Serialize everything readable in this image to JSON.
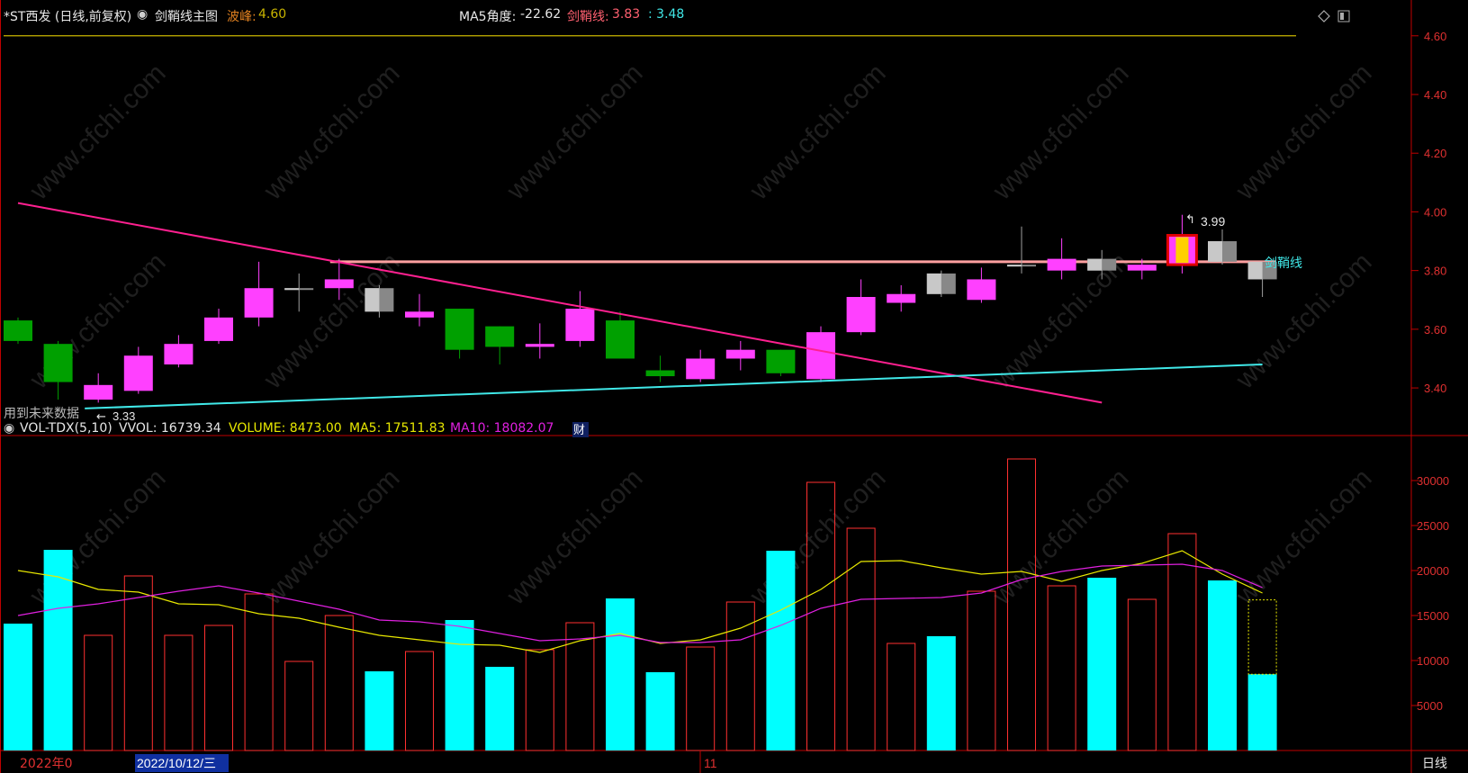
{
  "header": {
    "stock_title": "*ST西发 (日线,前复权)",
    "indicator_name": "剑鞘线主图",
    "peak_label": "波峰:",
    "peak_value": "4.60",
    "ma5_angle_label": "MA5角度:",
    "ma5_angle_value": "-22.62",
    "sword_label": "剑鞘线:",
    "sword_value": "3.83",
    "support_value": ": 3.48"
  },
  "volume_header": {
    "name": "VOL-TDX(5,10)",
    "vvol": "VVOL: 16739.34",
    "volume": "VOLUME: 8473.00",
    "ma5": "MA5: 17511.83",
    "ma10": "MA10: 18082.07"
  },
  "annotations": {
    "future_data": "用到未来数据",
    "low_marker": "3.33",
    "high_marker": "3.99",
    "sword_line_label": "剑鞘线",
    "finance_marker": "财"
  },
  "footer": {
    "year_label": "2022年0",
    "date_cursor": "2022/10/12/三",
    "month_label": "11",
    "period_button": "日线"
  },
  "colors": {
    "up": "#ff40ff",
    "down": "#00a000",
    "neutral": "#a0a0a0",
    "trend_line": "#ff2090",
    "support_line": "#40e8e8",
    "sword_line": "#ffa0a0",
    "peak_line": "#c8b400",
    "axis": "#c00000",
    "vol_up": "#ff3030",
    "vol_down": "#00ffff",
    "ma5": "#e8e800",
    "ma10": "#e020e0"
  },
  "chart_data": [
    {
      "type": "candlestick",
      "title": "*ST西发 (日线,前复权)",
      "ylim": [
        3.25,
        4.63
      ],
      "yticks": [
        "4.60",
        "4.40",
        "4.20",
        "4.00",
        "3.80",
        "3.60",
        "3.40"
      ],
      "peak_level": 4.6,
      "sword_level": 3.83,
      "candles": [
        {
          "o": 3.63,
          "h": 3.64,
          "l": 3.55,
          "c": 3.56,
          "s": "down"
        },
        {
          "o": 3.55,
          "h": 3.56,
          "l": 3.36,
          "c": 3.42,
          "s": "down"
        },
        {
          "o": 3.36,
          "h": 3.45,
          "l": 3.35,
          "c": 3.41,
          "s": "up"
        },
        {
          "o": 3.39,
          "h": 3.54,
          "l": 3.38,
          "c": 3.51,
          "s": "up"
        },
        {
          "o": 3.48,
          "h": 3.58,
          "l": 3.47,
          "c": 3.55,
          "s": "up"
        },
        {
          "o": 3.56,
          "h": 3.67,
          "l": 3.55,
          "c": 3.64,
          "s": "up"
        },
        {
          "o": 3.64,
          "h": 3.83,
          "l": 3.61,
          "c": 3.74,
          "s": "up"
        },
        {
          "o": 3.74,
          "h": 3.79,
          "l": 3.66,
          "c": 3.74,
          "s": "neutral"
        },
        {
          "o": 3.74,
          "h": 3.84,
          "l": 3.7,
          "c": 3.77,
          "s": "up"
        },
        {
          "o": 3.74,
          "h": 3.75,
          "l": 3.64,
          "c": 3.66,
          "s": "neutral"
        },
        {
          "o": 3.64,
          "h": 3.72,
          "l": 3.61,
          "c": 3.66,
          "s": "up"
        },
        {
          "o": 3.67,
          "h": 3.67,
          "l": 3.5,
          "c": 3.53,
          "s": "down"
        },
        {
          "o": 3.61,
          "h": 3.61,
          "l": 3.48,
          "c": 3.54,
          "s": "down"
        },
        {
          "o": 3.54,
          "h": 3.62,
          "l": 3.5,
          "c": 3.55,
          "s": "up"
        },
        {
          "o": 3.56,
          "h": 3.73,
          "l": 3.54,
          "c": 3.67,
          "s": "up"
        },
        {
          "o": 3.63,
          "h": 3.66,
          "l": 3.5,
          "c": 3.5,
          "s": "down"
        },
        {
          "o": 3.46,
          "h": 3.51,
          "l": 3.42,
          "c": 3.44,
          "s": "down"
        },
        {
          "o": 3.43,
          "h": 3.53,
          "l": 3.42,
          "c": 3.5,
          "s": "up"
        },
        {
          "o": 3.5,
          "h": 3.56,
          "l": 3.46,
          "c": 3.53,
          "s": "up"
        },
        {
          "o": 3.53,
          "h": 3.53,
          "l": 3.44,
          "c": 3.45,
          "s": "down"
        },
        {
          "o": 3.43,
          "h": 3.61,
          "l": 3.42,
          "c": 3.59,
          "s": "up"
        },
        {
          "o": 3.59,
          "h": 3.77,
          "l": 3.58,
          "c": 3.71,
          "s": "up"
        },
        {
          "o": 3.69,
          "h": 3.75,
          "l": 3.66,
          "c": 3.72,
          "s": "up"
        },
        {
          "o": 3.79,
          "h": 3.8,
          "l": 3.71,
          "c": 3.72,
          "s": "neutral"
        },
        {
          "o": 3.7,
          "h": 3.81,
          "l": 3.69,
          "c": 3.77,
          "s": "up"
        },
        {
          "o": 3.82,
          "h": 3.95,
          "l": 3.79,
          "c": 3.82,
          "s": "neutral"
        },
        {
          "o": 3.8,
          "h": 3.91,
          "l": 3.77,
          "c": 3.84,
          "s": "up"
        },
        {
          "o": 3.84,
          "h": 3.87,
          "l": 3.77,
          "c": 3.8,
          "s": "neutral"
        },
        {
          "o": 3.8,
          "h": 3.84,
          "l": 3.77,
          "c": 3.82,
          "s": "up"
        },
        {
          "o": 3.82,
          "h": 3.99,
          "l": 3.79,
          "c": 3.92,
          "s": "up"
        },
        {
          "o": 3.9,
          "h": 3.94,
          "l": 3.82,
          "c": 3.83,
          "s": "neutral"
        },
        {
          "o": 3.83,
          "h": 3.83,
          "l": 3.71,
          "c": 3.77,
          "s": "neutral"
        }
      ],
      "trend_line": {
        "from": [
          0,
          4.03
        ],
        "to": [
          27,
          3.35
        ]
      },
      "support_line": {
        "from": [
          2,
          3.33
        ],
        "to": [
          31,
          3.48
        ]
      }
    },
    {
      "type": "bar",
      "title": "VOL-TDX(5,10)",
      "ylim": [
        0,
        34000
      ],
      "yticks": [
        "30000",
        "25000",
        "20000",
        "15000",
        "10000",
        "5000"
      ],
      "volumes": [
        14100,
        22300,
        12800,
        19400,
        12800,
        13900,
        17400,
        9900,
        15000,
        8800,
        11000,
        14500,
        9300,
        11200,
        14200,
        16900,
        8700,
        11500,
        16500,
        22200,
        29800,
        24700,
        11900,
        12700,
        17700,
        32400,
        18300,
        19200,
        16800,
        24100,
        18900,
        8473
      ],
      "ma5": [
        20000,
        19300,
        17900,
        17600,
        16300,
        16200,
        15200,
        14700,
        13700,
        12800,
        12300,
        11800,
        11700,
        10900,
        12200,
        13000,
        11900,
        12300,
        13600,
        15600,
        17900,
        21000,
        21100,
        20300,
        19600,
        19900,
        18800,
        20000,
        20800,
        22200,
        19600,
        17500
      ],
      "ma10": [
        15000,
        15800,
        16300,
        17000,
        17700,
        18300,
        17500,
        16600,
        15700,
        14500,
        14300,
        13800,
        13000,
        12200,
        12400,
        12800,
        12000,
        12000,
        12300,
        13900,
        15800,
        16800,
        16900,
        17000,
        17500,
        19000,
        19900,
        20500,
        20600,
        20700,
        20000,
        18100
      ],
      "last_bar_forecast": 16739.34
    }
  ]
}
